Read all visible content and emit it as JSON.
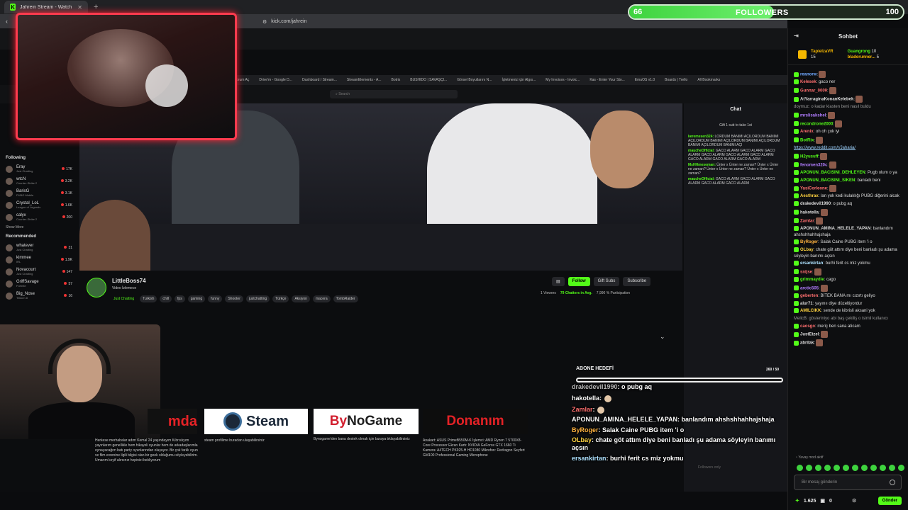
{
  "browser": {
    "tab_title": "Jahrein Stream - Watch Live o",
    "url": "kick.com/jahrein",
    "bookmarks": [
      "Forum Aç",
      "Drive'm - Google D...",
      "Dashboard / Stream...",
      "StreamElements - A...",
      "Botrix",
      "BUSHIDO | SAVAŞÇI...",
      "Görsel Boyutlarını N...",
      "İşletmeniz için Algıs...",
      "My Invoices - Invoic...",
      "Kas - Enter Your Sto...",
      "EmuOS v1.0",
      "Boards | Trello",
      "All Bookmarks"
    ]
  },
  "kick": {
    "search_placeholder": "Search",
    "following_header": "Following",
    "following": [
      {
        "name": "Eray",
        "sub": "Just Chatting",
        "count": "17K"
      },
      {
        "name": "wtcN",
        "sub": "Counter-Strike 2",
        "count": "3.2K"
      },
      {
        "name": "BarisG",
        "sub": "PUBG Mobile",
        "count": "3.1K"
      },
      {
        "name": "Crystal_LoL",
        "sub": "League of Legends",
        "count": "1.6K"
      },
      {
        "name": "calyx",
        "sub": "Counter-Strike 2",
        "count": "200"
      }
    ],
    "show_more": "Show More",
    "recommended_header": "Recommended",
    "recommended": [
      {
        "name": "whatever",
        "sub": "Just Chatting",
        "count": "31"
      },
      {
        "name": "kimmee",
        "sub": "IRL",
        "count": "1.9K"
      },
      {
        "name": "Novacourt",
        "sub": "Just Chatting",
        "count": "147"
      },
      {
        "name": "GriffSavage",
        "sub": "Fortnite",
        "count": "57"
      },
      {
        "name": "Big_Nose",
        "sub": "Tekken 8",
        "count": "16"
      }
    ],
    "streamer": "LittleBoss74",
    "stream_title": "Video İzlemece",
    "category": "Just Chatting",
    "tags": [
      "Turkish",
      "chill",
      "fps",
      "gaming",
      "funny",
      "Shooter",
      "justchatting",
      "Türkçe",
      "Aksiyon",
      "macera",
      "TombRaider"
    ],
    "buttons": {
      "follow": "Follow",
      "gift": "Gift Subs",
      "subscribe": "Subscribe"
    },
    "stats": {
      "viewers": "1 Viewers",
      "chatters": "79 Chatters in Avg.",
      "participation": "7,990 % Participation"
    },
    "chat_title": "Chat",
    "chat_pinned": "Gift 1 sub to take 1st",
    "chat_lines": [
      {
        "user": "keremesen324:",
        "text": "LORDUM BANIMI AÇILORDUM BANIMI AÇILORDUM BANIMI AÇILORDUM BANIMI AÇILORDUM BANIMI AÇILORDUM BANIMI AÇI"
      },
      {
        "user": "maucheOfficial:",
        "text": "GACO ALARM GACO ALARM GACO ALARM GACO ALARM GACO ALARM GACO ALARM GACO ALARM GACO ALARM GACO ALARM"
      },
      {
        "user": "MsHHmeseman:",
        "text": "Ünter x Ünter ne zaman? Ünter x Ünter ne zaman? Ünter x Ünter ne zaman? Ünter x Ünter ne zaman?"
      },
      {
        "user": "maucheOfficial:",
        "text": "GACO ALARM GACO ALARM GACO ALARM GACO ALARM GACO ALARM"
      }
    ],
    "goal_count": "260 / 50",
    "followers_only": "Followers only"
  },
  "panels": {
    "about_header": "ABONE HEDEFİ",
    "red_partial": "mda",
    "steam": "Steam",
    "bynogame_by": "By",
    "bynogame_rest": "NoGame",
    "donanim": "Donanım",
    "desc1": "Herkese merhabalar adım Kemal 24 yaşındayım Kıbrıslıyım yayınlarım genellikle hem hikayeli oyunlar hem de arkadaşlarımla oynayacağım batı party oyunlarından oluşuyor. Bir çok farklı oyun ve film evrenine ilgili bilgisi olan bir geek olduğumu söyleyebilirim. Umarım keyif alırsınız hepinizi bekliyorum",
    "desc2": "steam profilime buradan ulaşabilirsiniz",
    "desc3": "Bynogame'den bana destek olmak için buraya tıklayabilirsiniz",
    "desc4": "Anakart: ASUS PrimeB550M-K İşlemci: AMD Ryzen 7 5700X8-Core Processor Ekran Kartı: NVIDIA GeForce GTX 1660 Ti Kamera: A4TECH PK925-H HD1080 Mikrofon: Redragon Seyfert GM100 Professional Gaming Microphone"
  },
  "overlay_chat": [
    {
      "user": "drakedevil1990",
      "text": ": o pubg aq"
    },
    {
      "user": "hakotella",
      "text": ":"
    },
    {
      "user": "Zamlar",
      "text": ":"
    },
    {
      "user": "APONUN_AMINA_HELELE_YAPAN",
      "text": ": banlandım ahshshhahhajshaja"
    },
    {
      "user": "ByRoger",
      "text": ": Salak Caine PUBG item 'i o"
    },
    {
      "user": "OLbay",
      "text": ": chate göt attım diye beni banladı şu adama söyleyin banımı açsın"
    },
    {
      "user": "ersankirtan",
      "text": ": burhi ferit cs miz yokmu"
    }
  ],
  "followers_goal": {
    "current": "66",
    "label": "FOLLOWERS",
    "target": "100",
    "progress": 0.66
  },
  "right_chat": {
    "title": "Sohbet",
    "pinned_top": "TapielzaVR",
    "pinned_top_count": "15",
    "pinned_2": "Guangrong",
    "pinned_2_count": "10",
    "pinned_3": "bladerunner...",
    "pinned_3_count": "5",
    "messages": [
      {
        "user": "reanorw",
        "text": ":",
        "color": "#6fa8ff"
      },
      {
        "user": "Kelesek",
        "text": ": gaco ner",
        "color": "#ff6f6f"
      },
      {
        "user": "Gunnar_0009",
        "text": ":",
        "color": "#ff6f6f"
      },
      {
        "user": "AtYarraginaKonanKelebek",
        "text": ":",
        "color": "#ddd"
      },
      {
        "user": "",
        "text": "doymuz: o kadar klasten beni nasıl buldu",
        "color": "#999"
      },
      {
        "user": "mrslisakshel",
        "text": ":",
        "color": "#b27dff"
      },
      {
        "user": "recondrone2000",
        "text": ":",
        "color": "#53fc18"
      },
      {
        "user": "Arenix",
        "text": ": oh oh çok iyi",
        "color": "#ff6f6f"
      },
      {
        "user": "BotRix",
        "text": ":",
        "color": "#53fc18"
      },
      {
        "user": "",
        "text": "https://www.reddit.com/r/Jaharia/",
        "color": "#9ed3ff",
        "link": true
      },
      {
        "user": "H2yusuff",
        "text": ":",
        "color": "#53fc18"
      },
      {
        "user": "fenomen320c",
        "text": ":",
        "color": "#b27dff"
      },
      {
        "user": "APONUN_BACISINI_DEHLEYEN",
        "text": ": Pugb olum o ya",
        "color": "#53fc18"
      },
      {
        "user": "APONUN_BACISINI_SIKEN",
        "text": ": banladı beni",
        "color": "#53fc18"
      },
      {
        "user": "YasiCorleone",
        "text": ":",
        "color": "#ff6f6f"
      },
      {
        "user": "Aesthrax",
        "text": ": lan yok kedi kulaklığı PUBG diğerini alcak",
        "color": "#ffd340"
      },
      {
        "user": "drakedevil1990",
        "text": ": o pubg aq",
        "color": "#ddd"
      },
      {
        "user": "hakotella",
        "text": ":",
        "color": "#ddd"
      },
      {
        "user": "Zamlar",
        "text": ":",
        "color": "#ff6f6f"
      },
      {
        "user": "APONUN_AMINA_HELELE_YAPAN",
        "text": ": banlandım ahshshhahhajshaja",
        "color": "#ddd"
      },
      {
        "user": "ByRoger",
        "text": ": Salak Caine PUBG item 'i o",
        "color": "#ffb23f"
      },
      {
        "user": "OLbay",
        "text": ": chate göt attım diye beni banladı şu adama söyleyin banımı açsın",
        "color": "#ffd340"
      },
      {
        "user": "ersankirtan",
        "text": ": burhi ferit cs miz yokmu",
        "color": "#aee2ff"
      },
      {
        "user": "snijse",
        "text": ":",
        "color": "#ff6f6f"
      },
      {
        "user": "grimmaydie",
        "text": ": cago",
        "color": "#53fc18"
      },
      {
        "user": "arctic505",
        "text": ":",
        "color": "#b27dff"
      },
      {
        "user": "geberten",
        "text": ": BİTEK BANA mı cızırtı geliyo",
        "color": "#ff6f6f"
      },
      {
        "user": "alur71",
        "text": ": yayınıı diye düzeltiyordur",
        "color": "#ddd"
      },
      {
        "user": "AMILCIKK",
        "text": ": sende de kibrisli aksani yok",
        "color": "#ffd340"
      },
      {
        "user": "",
        "text": "MelicB: gösteriniyo abi baş çekiliş o isimli kullanıcı",
        "color": "#999"
      },
      {
        "user": "caosgo",
        "text": ": meriç ben sana aticam",
        "color": "#ff6f6f"
      },
      {
        "user": "JustEtzel",
        "text": ":",
        "color": "#ddd"
      },
      {
        "user": "abrilak",
        "text": ":",
        "color": "#ddd"
      }
    ],
    "slow_mode": "Yavaş mod aktif",
    "input_placeholder": "Bir mesaj gönderin",
    "balance": "1.625",
    "zero": "0",
    "send": "Gönder"
  }
}
